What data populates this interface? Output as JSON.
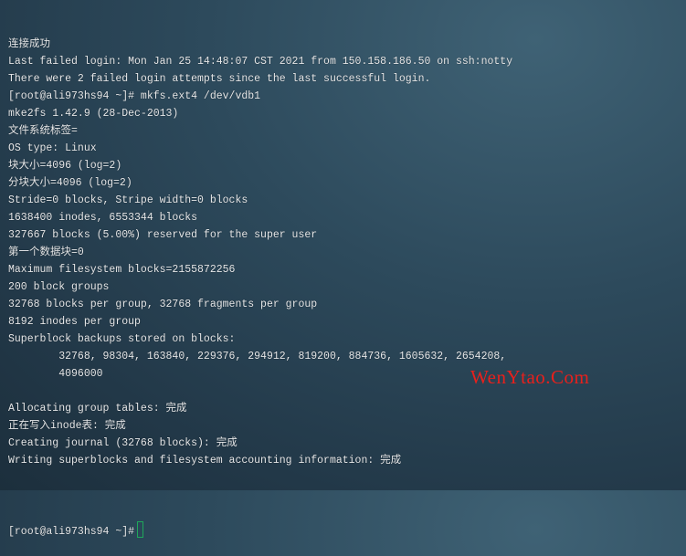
{
  "terminal": {
    "lines": [
      "连接成功",
      "Last failed login: Mon Jan 25 14:48:07 CST 2021 from 150.158.186.50 on ssh:notty",
      "There were 2 failed login attempts since the last successful login.",
      "[root@ali973hs94 ~]# mkfs.ext4 /dev/vdb1",
      "mke2fs 1.42.9 (28-Dec-2013)",
      "文件系统标签=",
      "OS type: Linux",
      "块大小=4096 (log=2)",
      "分块大小=4096 (log=2)",
      "Stride=0 blocks, Stripe width=0 blocks",
      "1638400 inodes, 6553344 blocks",
      "327667 blocks (5.00%) reserved for the super user",
      "第一个数据块=0",
      "Maximum filesystem blocks=2155872256",
      "200 block groups",
      "32768 blocks per group, 32768 fragments per group",
      "8192 inodes per group",
      "Superblock backups stored on blocks:",
      "        32768, 98304, 163840, 229376, 294912, 819200, 884736, 1605632, 2654208,",
      "        4096000",
      "",
      "Allocating group tables: 完成",
      "正在写入inode表: 完成",
      "Creating journal (32768 blocks): 完成",
      "Writing superblocks and filesystem accounting information: 完成",
      ""
    ],
    "prompt": "[root@ali973hs94 ~]#",
    "cursor_color": "#1fa85a",
    "text_color": "#e6e8ea"
  },
  "watermark": "WenYtao.Com"
}
